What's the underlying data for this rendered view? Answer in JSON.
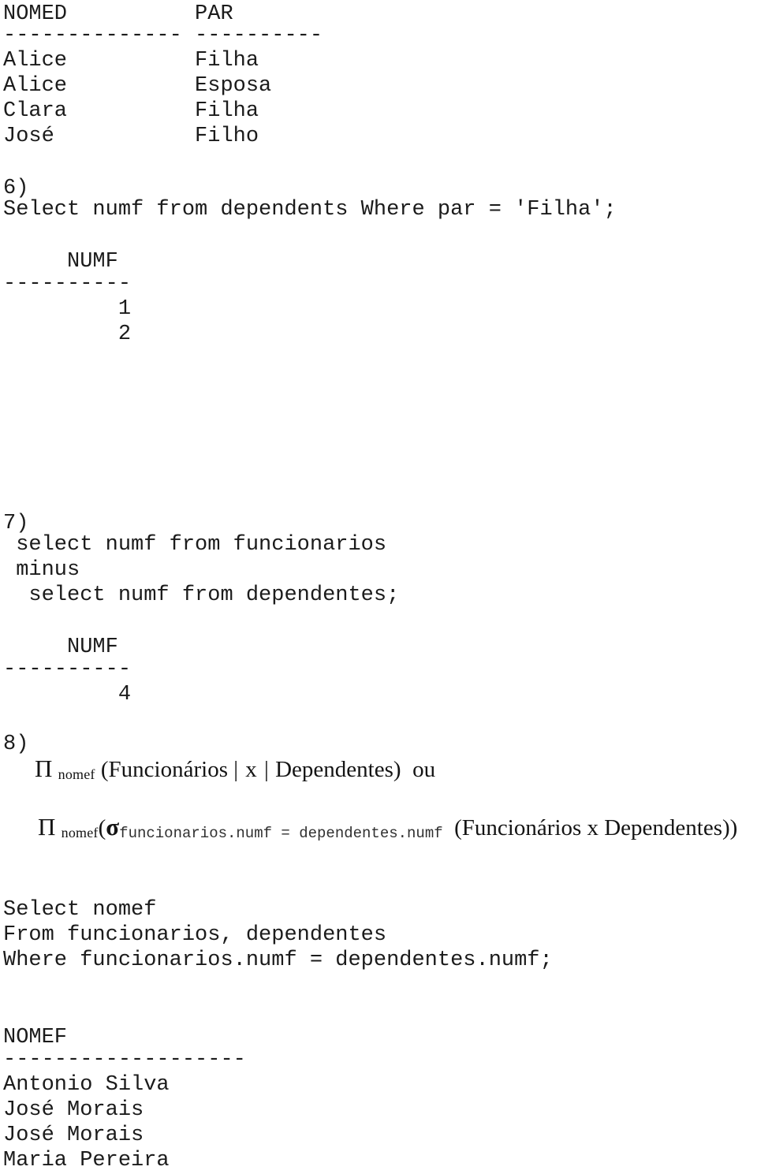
{
  "document": {
    "language": "pt-BR",
    "topic": "SQL e Álgebra Relacional - exercícios 6, 7, 8"
  },
  "result_table_dependents": {
    "headers": "NOMED          PAR",
    "separator": "-------------- ----------",
    "rows": [
      "Alice          Filha",
      "Alice          Esposa",
      "Clara          Filha",
      "José           Filho"
    ],
    "columns": [
      "NOMED",
      "PAR"
    ],
    "data": [
      [
        "Alice",
        "Filha"
      ],
      [
        "Alice",
        "Esposa"
      ],
      [
        "Clara",
        "Filha"
      ],
      [
        "José",
        "Filho"
      ]
    ]
  },
  "section6": {
    "number": "6)",
    "query": "Select numf from dependents Where par = 'Filha';",
    "result": {
      "header": "     NUMF",
      "separator": "----------",
      "rows": [
        "         1",
        "         2"
      ],
      "column": "NUMF",
      "values": [
        "1",
        "2"
      ]
    }
  },
  "section7": {
    "number": "7)",
    "query_lines": [
      " select numf from funcionarios",
      " minus",
      "  select numf from dependentes;"
    ],
    "result": {
      "header": "     NUMF",
      "separator": "----------",
      "rows": [
        "         4"
      ],
      "column": "NUMF",
      "values": [
        "4"
      ]
    }
  },
  "section8": {
    "number": "8)",
    "formula1": {
      "pi": "Π",
      "pi_subscript": "nomef",
      "open_paren": "(",
      "left_relation": "Funcionários",
      "join_symbol": "| x |",
      "right_relation": "Dependentes",
      "close_paren": ")",
      "alt_word": "ou",
      "plain": "Π nomef (Funcionários | x | Dependentes)  ou"
    },
    "formula2": {
      "pi": "Π",
      "pi_subscript": "nomef",
      "open_paren": "(",
      "sigma": "σ",
      "sigma_subscript": "funcionarios.numf = dependentes.numf",
      "inner": "(Funcionários  x  Dependentes))",
      "plain": "Π nomef (σ funcionarios.numf = dependentes.numf (Funcionários x Dependentes))"
    },
    "sql_lines": [
      "Select nomef",
      "From funcionarios, dependentes",
      "Where funcionarios.numf = dependentes.numf;"
    ],
    "result": {
      "header": "NOMEF",
      "separator": "-------------------",
      "rows": [
        "Antonio Silva",
        "José Morais",
        "José Morais",
        "Maria Pereira"
      ],
      "column": "NOMEF",
      "values": [
        "Antonio Silva",
        "José Morais",
        "José Morais",
        "Maria Pereira"
      ]
    }
  }
}
